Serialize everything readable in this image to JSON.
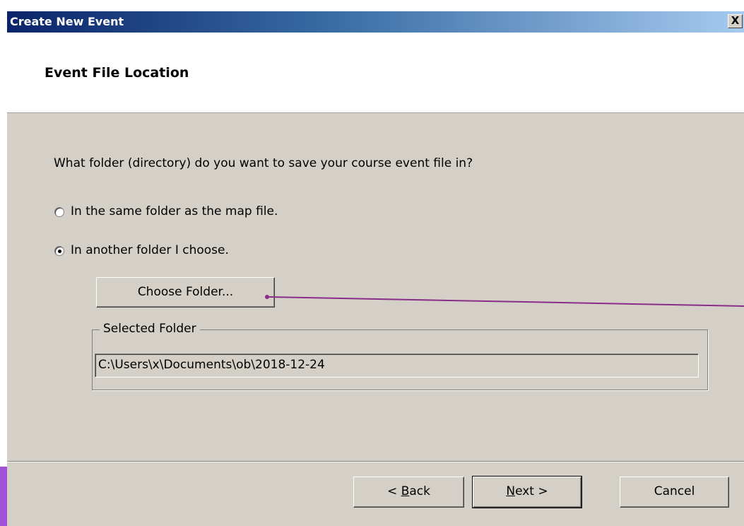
{
  "window": {
    "title": "Create New Event",
    "close_glyph": "X"
  },
  "page": {
    "heading": "Event File Location",
    "question": "What folder (directory) do you want to save your course event file in?"
  },
  "options": {
    "same_folder_label": "In the same folder as the map file.",
    "same_folder_checked": false,
    "another_folder_label": "In another folder I choose.",
    "another_folder_checked": true
  },
  "choose_button_label": "Choose Folder...",
  "selected_folder": {
    "group_label": "Selected Folder",
    "path": "C:\\Users\\x\\Documents\\ob\\2018-12-24"
  },
  "footer": {
    "back": {
      "prefix": "< ",
      "mnemonic": "B",
      "rest": "ack"
    },
    "next": {
      "mnemonic": "N",
      "rest": "ext >"
    },
    "cancel": "Cancel"
  },
  "colors": {
    "titlebar_start": "#0a246a",
    "titlebar_end": "#a6caf0",
    "dialog_face": "#d4d0c8",
    "annotation": "#8b2c8b",
    "side_strip": "#a152d6"
  },
  "icons": {
    "close": "close-icon",
    "radio": "radio-icon"
  }
}
